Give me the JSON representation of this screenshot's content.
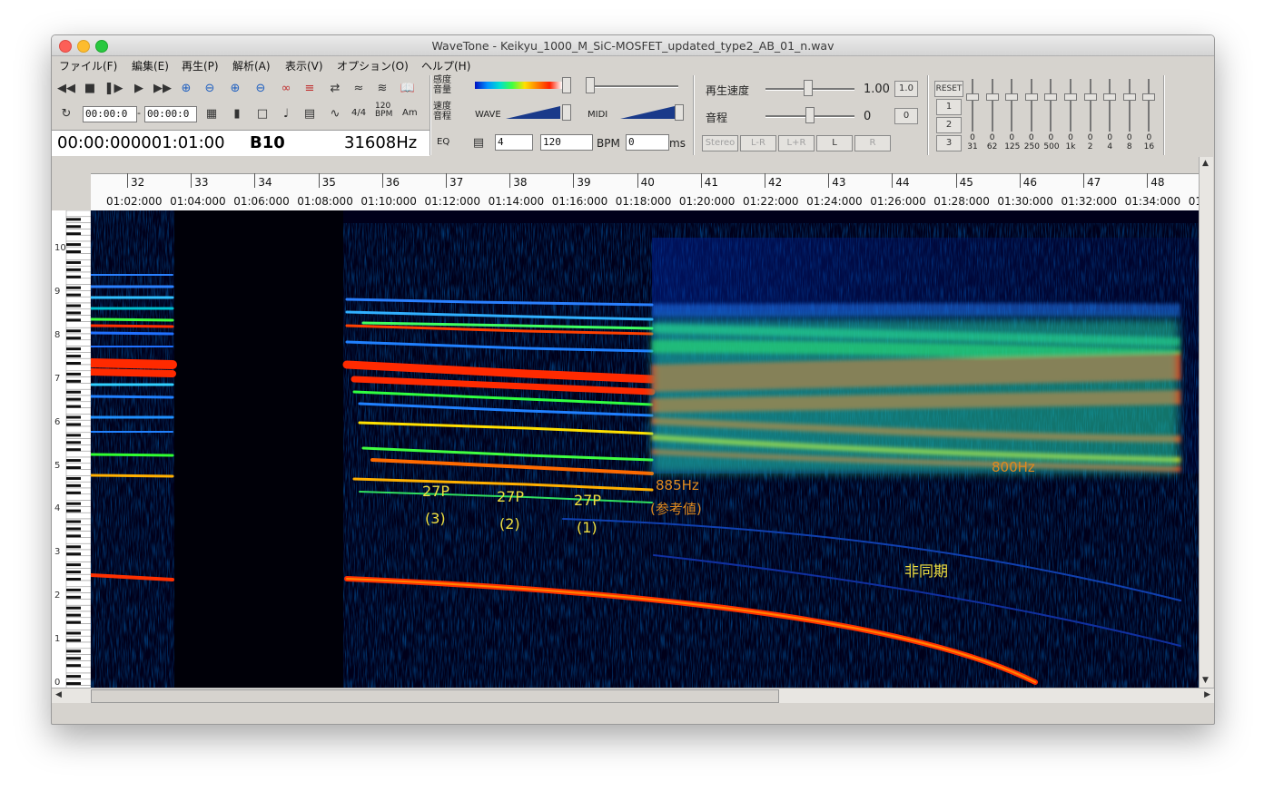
{
  "window": {
    "title": "WaveTone - Keikyu_1000_M_SiC-MOSFET_updated_type2_AB_01_n.wav"
  },
  "menu": [
    "ファイル(F)",
    "編集(E)",
    "再生(P)",
    "解析(A)",
    "表示(V)",
    "オプション(O)",
    "ヘルプ(H)"
  ],
  "toolbar": {
    "time_start": "00:00:0",
    "time_end": "00:00:0",
    "time_sep": "-",
    "sig_label": "4/4",
    "bpm_small_top": "120",
    "bpm_small_bot": "BPM",
    "am_label": "Am",
    "position_readout": "00:00:000001:01:00",
    "note_readout": "B10",
    "freq_readout": "31608Hz",
    "sens_label_1": "感度",
    "sens_label_2": "音量",
    "speed_label_1": "速度",
    "speed_label_2": "音程",
    "eq_label": "EQ",
    "wave_label": "WAVE",
    "midi_label": "MIDI",
    "beats_value": "4",
    "tempo_value": "120",
    "bpm_label": "BPM",
    "ms_value": "0",
    "ms_label": "ms",
    "playback_speed_label": "再生速度",
    "playback_speed_value": "1.00",
    "playback_speed_btn": "1.0",
    "pitch_label": "音程",
    "pitch_value": "0",
    "pitch_btn": "0",
    "stereo_buttons": [
      "Stereo",
      "L-R",
      "L+R",
      "L",
      "R"
    ],
    "reset_label": "RESET",
    "preset_buttons": [
      "1",
      "2",
      "3"
    ],
    "eq_bands": [
      "31",
      "62",
      "125",
      "250",
      "500",
      "1k",
      "2",
      "4",
      "8",
      "16"
    ],
    "eq_values": [
      "0",
      "0",
      "0",
      "0",
      "0",
      "0",
      "0",
      "0",
      "0",
      "0"
    ]
  },
  "ruler": {
    "measures": [
      "32",
      "33",
      "34",
      "35",
      "36",
      "37",
      "38",
      "39",
      "40",
      "41",
      "42",
      "43",
      "44",
      "45",
      "46",
      "47",
      "48"
    ],
    "times": [
      "01:02:000",
      "01:04:000",
      "01:06:000",
      "01:08:000",
      "01:10:000",
      "01:12:000",
      "01:14:000",
      "01:16:000",
      "01:18:000",
      "01:20:000",
      "01:22:000",
      "01:24:000",
      "01:26:000",
      "01:28:000",
      "01:30:000",
      "01:32:000",
      "01:34:000",
      "01"
    ]
  },
  "keyboard": {
    "octaves": [
      "10",
      "9",
      "8",
      "7",
      "6",
      "5",
      "4",
      "3",
      "2",
      "1",
      "0"
    ]
  },
  "annotations": {
    "p3_a": "27P",
    "p3_b": "(3)",
    "p2_a": "27P",
    "p2_b": "(2)",
    "p1_a": "27P",
    "p1_b": "(1)",
    "hz885_a": "885Hz",
    "hz885_b": "(参考値)",
    "hz800": "800Hz",
    "async": "非同期"
  },
  "colors": {
    "annotation_yellow": "#f0e040",
    "annotation_orange": "#e08a1e",
    "window_bg": "#d6d3ce"
  }
}
